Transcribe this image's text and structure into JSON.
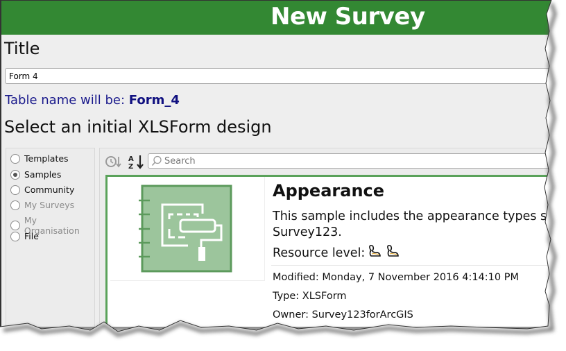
{
  "header": {
    "title": "New Survey",
    "color": "#338833"
  },
  "title_section": {
    "label": "Title",
    "input_value": "Form 4",
    "table_name_prefix": "Table name will be: ",
    "table_name_value": "Form_4"
  },
  "design_section": {
    "label": "Select an initial XLSForm design"
  },
  "sources": [
    {
      "label": "Templates",
      "checked": false,
      "enabled": true
    },
    {
      "label": "Samples",
      "checked": true,
      "enabled": true
    },
    {
      "label": "Community",
      "checked": false,
      "enabled": true
    },
    {
      "label": "My Surveys",
      "checked": false,
      "enabled": false
    },
    {
      "label": "My Organisation",
      "checked": false,
      "enabled": false
    },
    {
      "label": "File",
      "checked": false,
      "enabled": true
    }
  ],
  "toolbar": {
    "sort_by_date_icon": "clock-sort-icon",
    "sort_alpha_icon": "az-sort-icon",
    "search_placeholder": "Search",
    "search_value": ""
  },
  "selected_sample": {
    "title": "Appearance",
    "description_line1": "This sample includes the appearance types s",
    "description_line2": "Survey123.",
    "resource_label": "Resource level:",
    "resource_level": 2,
    "modified": "Modified: Monday, 7 November 2016 4:14:10 PM",
    "type": "Type: XLSForm",
    "owner": "Owner: Survey123forArcGIS",
    "thumbnail_icon": "notebook-paint-roller-icon",
    "accent_color": "#5aa25a"
  }
}
